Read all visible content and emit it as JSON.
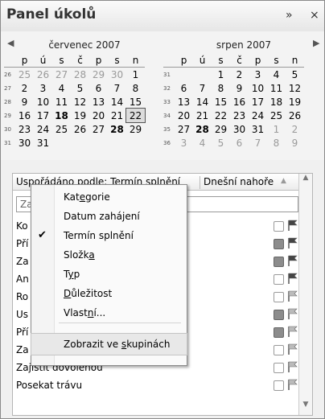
{
  "panel": {
    "title": "Panel úkolů",
    "expand_glyph": "»",
    "close_glyph": "×"
  },
  "calendar": {
    "months": [
      {
        "name": "červenec 2007",
        "day_names": [
          "p",
          "ú",
          "s",
          "č",
          "p",
          "s",
          "n"
        ],
        "weeks": [
          {
            "wk": "26",
            "days": [
              [
                "25",
                "g"
              ],
              [
                "26",
                "g"
              ],
              [
                "27",
                "g"
              ],
              [
                "28",
                "g"
              ],
              [
                "29",
                "g"
              ],
              [
                "30",
                "g"
              ],
              [
                "1",
                ""
              ]
            ]
          },
          {
            "wk": "27",
            "days": [
              [
                "2",
                ""
              ],
              [
                "3",
                ""
              ],
              [
                "4",
                ""
              ],
              [
                "5",
                ""
              ],
              [
                "6",
                ""
              ],
              [
                "7",
                ""
              ],
              [
                "8",
                ""
              ]
            ]
          },
          {
            "wk": "28",
            "days": [
              [
                "9",
                ""
              ],
              [
                "10",
                ""
              ],
              [
                "11",
                ""
              ],
              [
                "12",
                ""
              ],
              [
                "13",
                ""
              ],
              [
                "14",
                ""
              ],
              [
                "15",
                ""
              ]
            ]
          },
          {
            "wk": "29",
            "days": [
              [
                "16",
                ""
              ],
              [
                "17",
                ""
              ],
              [
                "18",
                "b"
              ],
              [
                "19",
                ""
              ],
              [
                "20",
                ""
              ],
              [
                "21",
                ""
              ],
              [
                "22",
                "sel"
              ]
            ]
          },
          {
            "wk": "30",
            "days": [
              [
                "23",
                ""
              ],
              [
                "24",
                ""
              ],
              [
                "25",
                ""
              ],
              [
                "26",
                ""
              ],
              [
                "27",
                ""
              ],
              [
                "28",
                "b"
              ],
              [
                "29",
                ""
              ]
            ]
          },
          {
            "wk": "31",
            "days": [
              [
                "30",
                ""
              ],
              [
                "31",
                ""
              ],
              [
                "",
                ""
              ],
              [
                "",
                ""
              ],
              [
                "",
                ""
              ],
              [
                "",
                ""
              ],
              [
                "",
                ""
              ]
            ]
          }
        ]
      },
      {
        "name": "srpen 2007",
        "day_names": [
          "p",
          "ú",
          "s",
          "č",
          "p",
          "s",
          "n"
        ],
        "weeks": [
          {
            "wk": "31",
            "days": [
              [
                "",
                ""
              ],
              [
                "",
                ""
              ],
              [
                "1",
                ""
              ],
              [
                "2",
                ""
              ],
              [
                "3",
                ""
              ],
              [
                "4",
                ""
              ],
              [
                "5",
                ""
              ]
            ]
          },
          {
            "wk": "32",
            "days": [
              [
                "6",
                ""
              ],
              [
                "7",
                ""
              ],
              [
                "8",
                ""
              ],
              [
                "9",
                ""
              ],
              [
                "10",
                ""
              ],
              [
                "11",
                ""
              ],
              [
                "12",
                ""
              ]
            ]
          },
          {
            "wk": "33",
            "days": [
              [
                "13",
                ""
              ],
              [
                "14",
                ""
              ],
              [
                "15",
                ""
              ],
              [
                "16",
                ""
              ],
              [
                "17",
                ""
              ],
              [
                "18",
                ""
              ],
              [
                "19",
                ""
              ]
            ]
          },
          {
            "wk": "34",
            "days": [
              [
                "20",
                ""
              ],
              [
                "21",
                ""
              ],
              [
                "22",
                ""
              ],
              [
                "23",
                ""
              ],
              [
                "24",
                ""
              ],
              [
                "25",
                ""
              ],
              [
                "26",
                ""
              ]
            ]
          },
          {
            "wk": "35",
            "days": [
              [
                "27",
                ""
              ],
              [
                "28",
                "b"
              ],
              [
                "29",
                ""
              ],
              [
                "30",
                ""
              ],
              [
                "31",
                ""
              ],
              [
                "1",
                "g"
              ],
              [
                "2",
                "g"
              ]
            ]
          },
          {
            "wk": "36",
            "days": [
              [
                "3",
                "g"
              ],
              [
                "4",
                "g"
              ],
              [
                "5",
                "g"
              ],
              [
                "6",
                "g"
              ],
              [
                "7",
                "g"
              ],
              [
                "8",
                "g"
              ],
              [
                "9",
                "g"
              ]
            ]
          }
        ]
      }
    ]
  },
  "tasks": {
    "sort_label": "Uspořádáno podle: Termín splnění",
    "sort_right": "Dnešní nahoře",
    "new_task_placeholder": "Za",
    "rows": [
      {
        "label": "Ko",
        "flag": "dark",
        "checkbox": "empty"
      },
      {
        "label": "Pří",
        "flag": "dark",
        "checkbox": "filled"
      },
      {
        "label": "Za",
        "flag": "dark",
        "checkbox": "filled"
      },
      {
        "label": "An",
        "flag": "dark",
        "checkbox": "empty"
      },
      {
        "label": "Ro",
        "flag": "light",
        "checkbox": "empty"
      },
      {
        "label": "Us",
        "flag": "light",
        "checkbox": "filled"
      },
      {
        "label": "Pří",
        "flag": "light",
        "checkbox": "filled"
      },
      {
        "label": "Za",
        "flag": "light",
        "checkbox": "empty"
      },
      {
        "label": "Zajistit dovolenou",
        "flag": "light",
        "checkbox": "empty"
      },
      {
        "label": "Posekat trávu",
        "flag": "light",
        "checkbox": "empty"
      }
    ]
  },
  "menu": {
    "items": [
      {
        "pre": "Kat",
        "u": "e",
        "post": "gorie",
        "checked": false
      },
      {
        "pre": "Datum zahájení",
        "u": "",
        "post": "",
        "checked": false
      },
      {
        "pre": "Termín splnění",
        "u": "",
        "post": "",
        "checked": true
      },
      {
        "pre": "Složk",
        "u": "a",
        "post": "",
        "checked": false
      },
      {
        "pre": "T",
        "u": "y",
        "post": "p",
        "checked": false
      },
      {
        "pre": "",
        "u": "D",
        "post": "ůležitost",
        "checked": false
      },
      {
        "pre": "Vlast",
        "u": "n",
        "post": "í...",
        "checked": false
      }
    ],
    "group_item": {
      "pre": "Zobrazit ve ",
      "u": "s",
      "post": "kupinách"
    },
    "check_glyph": "✔"
  },
  "colors": {
    "flag_dark": "#444444",
    "flag_light": "#bbbbbb",
    "selected_outline": "#555555"
  }
}
